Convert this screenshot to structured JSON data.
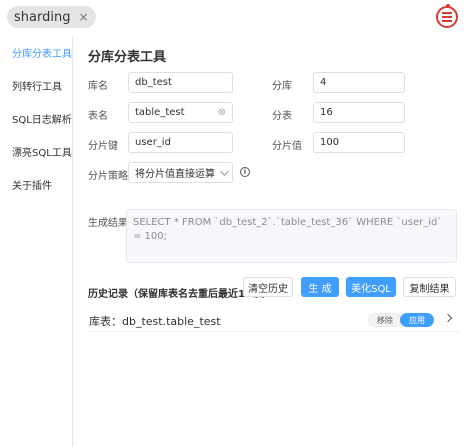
{
  "tab": {
    "label": "sharding",
    "close": "×"
  },
  "sidebar": {
    "items": [
      {
        "label": "分库分表工具",
        "active": true
      },
      {
        "label": "列转行工具",
        "active": false
      },
      {
        "label": "SQL日志解析",
        "active": false
      },
      {
        "label": "漂亮SQL工具",
        "active": false
      },
      {
        "label": "关于插件",
        "active": false
      }
    ]
  },
  "page": {
    "title": "分库分表工具"
  },
  "form": {
    "db_name_label": "库名",
    "db_name_value": "db_test",
    "db_count_label": "分库",
    "db_count_value": "4",
    "table_name_label": "表名",
    "table_name_value": "table_test",
    "table_count_label": "分表",
    "table_count_value": "16",
    "shard_key_label": "分片键",
    "shard_key_value": "user_id",
    "shard_value_label": "分片值",
    "shard_value_value": "100",
    "strategy_label": "分片策略",
    "strategy_value": "将分片值直接运算",
    "result_label": "生成结果",
    "result_value": "SELECT * FROM `db_test_2`.`table_test_36` WHERE `user_id` = 100;"
  },
  "history": {
    "title": "历史记录（保留库表名去重后最近10条）",
    "clear_label": "清空历史",
    "generate_label": "生 成",
    "beautify_label": "美化SQL",
    "copy_label": "复制结果",
    "rows": [
      {
        "text": "库表：db_test.table_test",
        "remove_label": "移除",
        "apply_label": "应用"
      }
    ]
  },
  "colors": {
    "accent": "#409eff",
    "brand": "#d83b32"
  }
}
